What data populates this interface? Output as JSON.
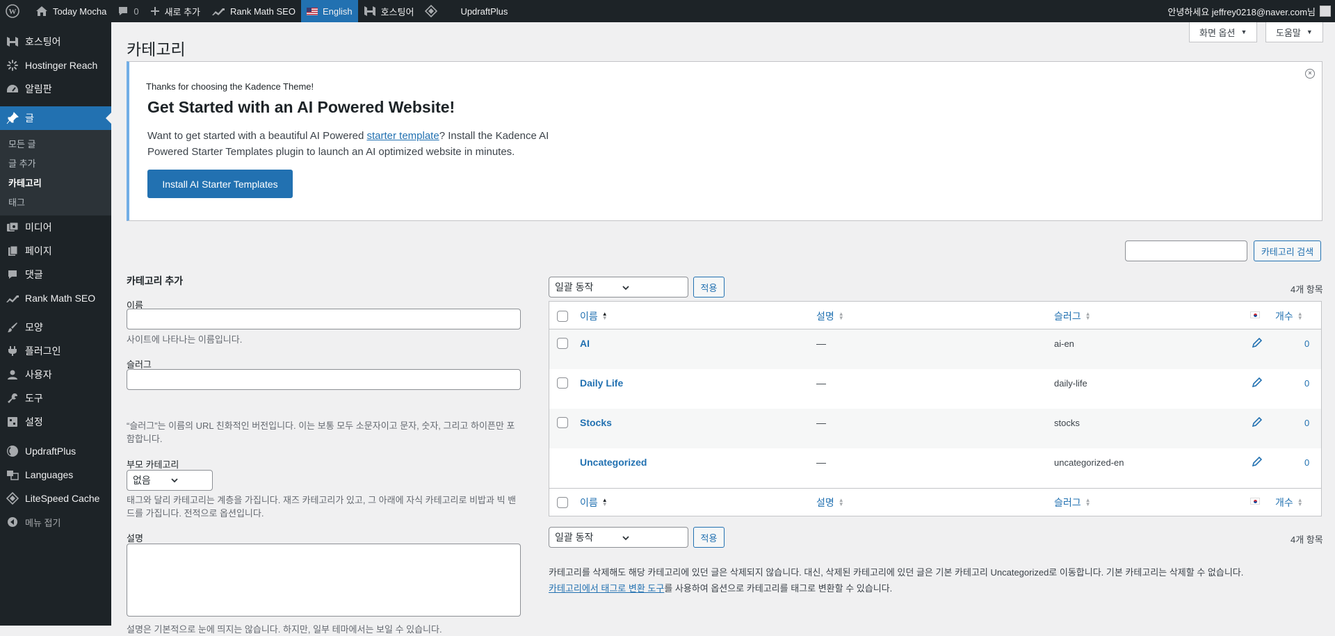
{
  "adminbar": {
    "site_name": "Today Mocha",
    "comments_count": "0",
    "new_label": "새로 추가",
    "rankmath_label": "Rank Math SEO",
    "language_label": "English",
    "hostinger_label": "호스팅어",
    "updraft_label": "UpdraftPlus",
    "greeting": "안녕하세요 jeffrey0218@naver.com님"
  },
  "sidebar": {
    "items": [
      {
        "label": "호스팅어",
        "icon": "hostinger-icon"
      },
      {
        "label": "Hostinger Reach",
        "icon": "reach-icon"
      },
      {
        "label": "알림판",
        "icon": "dashboard-icon"
      },
      {
        "label": "글",
        "icon": "pin-icon"
      },
      {
        "label": "미디어",
        "icon": "media-icon"
      },
      {
        "label": "페이지",
        "icon": "page-icon"
      },
      {
        "label": "댓글",
        "icon": "comment-icon"
      },
      {
        "label": "Rank Math SEO",
        "icon": "rankmath-icon"
      },
      {
        "label": "모양",
        "icon": "brush-icon"
      },
      {
        "label": "플러그인",
        "icon": "plugin-icon"
      },
      {
        "label": "사용자",
        "icon": "user-icon"
      },
      {
        "label": "도구",
        "icon": "wrench-icon"
      },
      {
        "label": "설정",
        "icon": "settings-icon"
      },
      {
        "label": "UpdraftPlus",
        "icon": "updraft-icon"
      },
      {
        "label": "Languages",
        "icon": "languages-icon"
      },
      {
        "label": "LiteSpeed Cache",
        "icon": "litespeed-icon"
      },
      {
        "label": "메뉴 접기",
        "icon": "collapse-icon"
      }
    ],
    "submenu": [
      "모든 글",
      "글 추가",
      "카테고리",
      "태그"
    ]
  },
  "page": {
    "title": "카테고리",
    "screen_options": "화면 옵션",
    "help": "도움말"
  },
  "notice": {
    "small": "Thanks for choosing the Kadence Theme!",
    "heading": "Get Started with an AI Powered Website!",
    "text_before": "Want to get started with a beautiful AI Powered ",
    "link": "starter template",
    "text_after": "? Install the Kadence AI Powered Starter Templates plugin to launch an AI optimized website in minutes.",
    "button": "Install AI Starter Templates"
  },
  "search": {
    "button": "카테고리 검색",
    "value": ""
  },
  "form": {
    "heading": "카테고리 추가",
    "name_label": "이름",
    "name_value": "",
    "name_help": "사이트에 나타나는 이름입니다.",
    "slug_label": "슬러그",
    "slug_value": "",
    "slug_help": "“슬러그”는 이름의 URL 친화적인 버전입니다. 이는 보통 모두 소문자이고 문자, 숫자, 그리고 하이픈만 포함합니다.",
    "parent_label": "부모 카테고리",
    "parent_value": "없음",
    "parent_help": "태그와 달리 카테고리는 계층을 가집니다. 재즈 카테고리가 있고, 그 아래에 자식 카테고리로 비밥과 빅 밴드를 가집니다. 전적으로 옵션입니다.",
    "desc_label": "설명",
    "desc_help": "설명은 기본적으로 눈에 띄지는 않습니다. 하지만, 일부 테마에서는 보일 수 있습니다."
  },
  "table": {
    "bulk_action": "일괄 동작",
    "apply": "적용",
    "count": "4개 항목",
    "columns": {
      "name": "이름",
      "description": "설명",
      "slug": "슬러그",
      "count": "개수"
    },
    "rows": [
      {
        "name": "AI",
        "description": "—",
        "slug": "ai-en",
        "count": "0",
        "has_checkbox": true
      },
      {
        "name": "Daily Life",
        "description": "—",
        "slug": "daily-life",
        "count": "0",
        "has_checkbox": true
      },
      {
        "name": "Stocks",
        "description": "—",
        "slug": "stocks",
        "count": "0",
        "has_checkbox": true
      },
      {
        "name": "Uncategorized",
        "description": "—",
        "slug": "uncategorized-en",
        "count": "0",
        "has_checkbox": false
      }
    ]
  },
  "footnote": {
    "line1": "카테고리를 삭제해도 해당 카테고리에 있던 글은 삭제되지 않습니다. 대신, 삭제된 카테고리에 있던 글은 기본 카테고리 Uncategorized로 이동합니다. 기본 카테고리는 삭제할 수 없습니다.",
    "line2_link": "카테고리에서 태그로 변환 도구",
    "line2_rest": "를 사용하여 옵션으로 카테고리를 태그로 변환할 수 있습니다."
  },
  "colors": {
    "accent": "#2271b1",
    "adminbar": "#1d2327",
    "notice_border": "#72aee6"
  }
}
